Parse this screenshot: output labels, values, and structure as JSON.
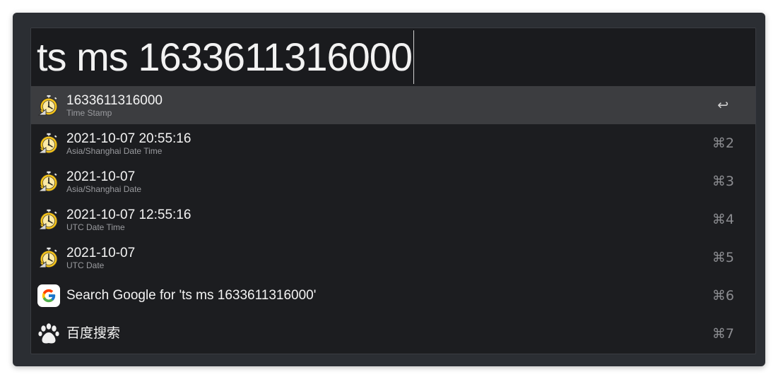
{
  "query": {
    "value": "ts ms 1633611316000"
  },
  "results": [
    {
      "title": "1633611316000",
      "subtitle": "Time Stamp",
      "shortcut": "↩",
      "icon": "stopwatch-icon",
      "selected": true
    },
    {
      "title": "2021-10-07 20:55:16",
      "subtitle": "Asia/Shanghai Date Time",
      "shortcut": "⌘2",
      "icon": "stopwatch-icon"
    },
    {
      "title": "2021-10-07",
      "subtitle": "Asia/Shanghai Date",
      "shortcut": "⌘3",
      "icon": "stopwatch-icon"
    },
    {
      "title": "2021-10-07 12:55:16",
      "subtitle": "UTC Date Time",
      "shortcut": "⌘4",
      "icon": "stopwatch-icon"
    },
    {
      "title": "2021-10-07",
      "subtitle": "UTC Date",
      "shortcut": "⌘5",
      "icon": "stopwatch-icon"
    },
    {
      "title": "Search Google for 'ts ms 1633611316000'",
      "shortcut": "⌘6",
      "icon": "google-icon"
    },
    {
      "title": "百度搜索",
      "shortcut": "⌘7",
      "icon": "paw-icon"
    }
  ],
  "colors": {
    "window_bg": "#2b2e33",
    "panel_bg": "#1c1d20",
    "selected_row": "#3c3d40",
    "text_primary": "#f3f3f3",
    "text_secondary": "#9a9b9f"
  }
}
